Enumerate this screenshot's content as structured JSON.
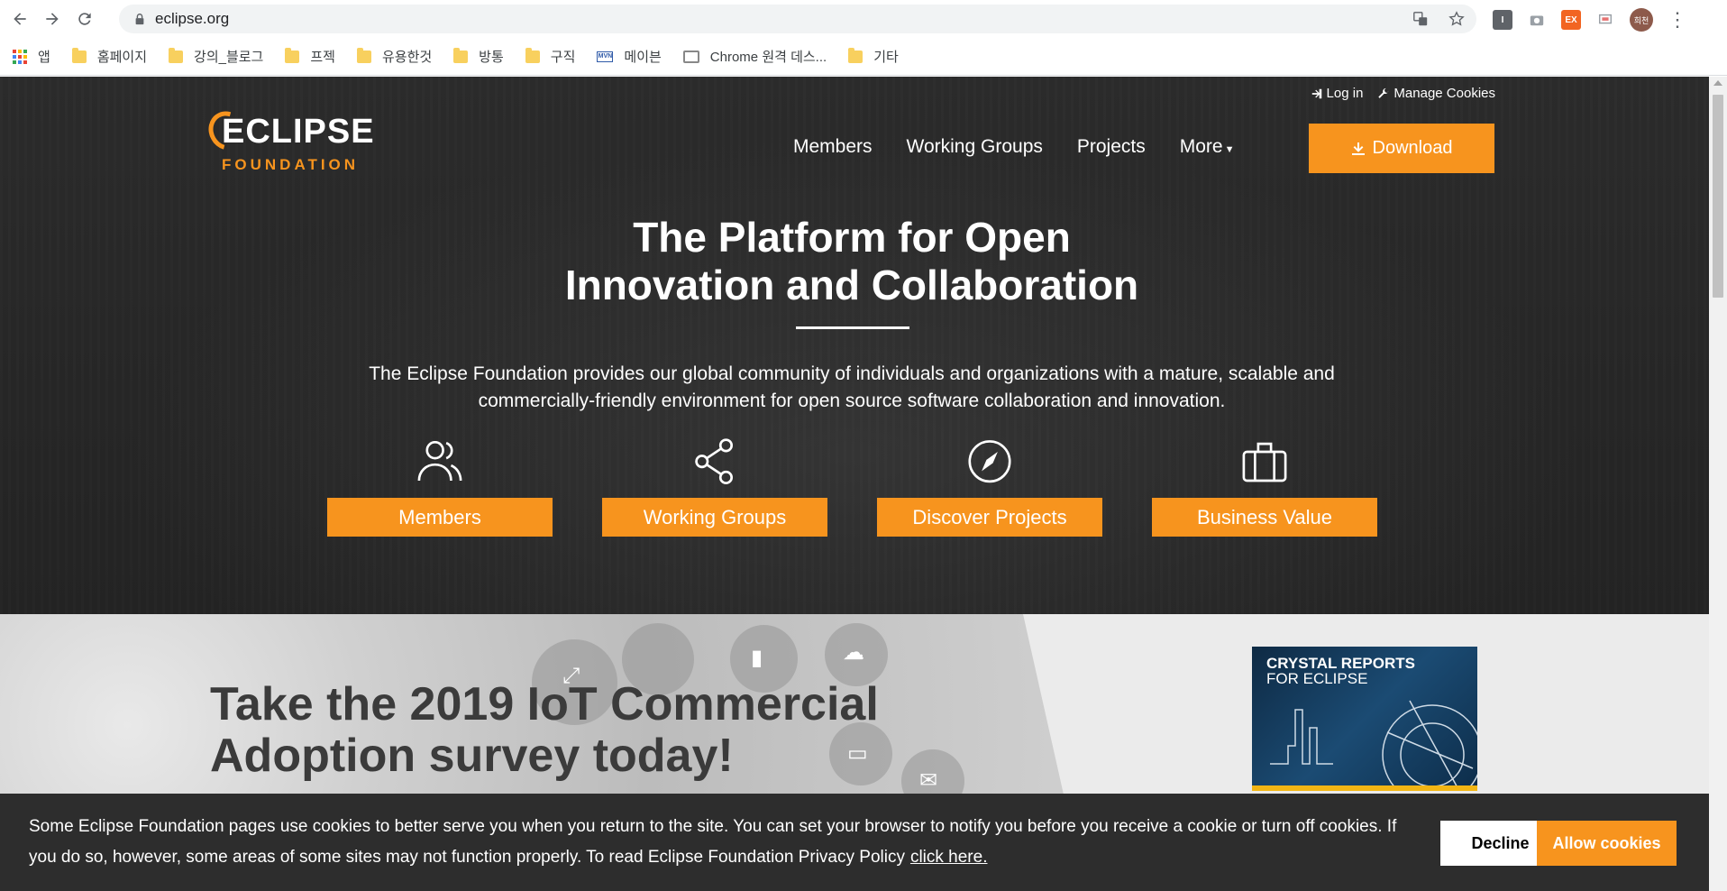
{
  "browser": {
    "url": "eclipse.org",
    "avatar_text": "희천",
    "extensions": [
      "I",
      "camera-icon",
      "EX",
      "cast-icon"
    ]
  },
  "bookmarks": [
    {
      "label": "앱",
      "type": "apps"
    },
    {
      "label": "홈페이지",
      "type": "folder"
    },
    {
      "label": "강의_블로그",
      "type": "folder"
    },
    {
      "label": "프젝",
      "type": "folder"
    },
    {
      "label": "유용한것",
      "type": "folder"
    },
    {
      "label": "방통",
      "type": "folder"
    },
    {
      "label": "구직",
      "type": "folder"
    },
    {
      "label": "메이븐",
      "type": "mvn"
    },
    {
      "label": "Chrome 원격 데스...",
      "type": "remote"
    },
    {
      "label": "기타",
      "type": "folder"
    }
  ],
  "header": {
    "login": "Log in",
    "manage_cookies": "Manage Cookies",
    "logo_top": "ECLIPSE",
    "logo_bottom": "FOUNDATION",
    "nav": [
      "Members",
      "Working Groups",
      "Projects",
      "More"
    ],
    "download": "Download"
  },
  "hero": {
    "title_line1": "The Platform for Open",
    "title_line2": "Innovation and Collaboration",
    "lead_line1": "The Eclipse Foundation provides our global community of individuals and organizations with a mature, scalable and",
    "lead_line2": "commercially-friendly environment for open source software collaboration and innovation.",
    "features": [
      {
        "label": "Members",
        "icon": "users-icon"
      },
      {
        "label": "Working Groups",
        "icon": "share-icon"
      },
      {
        "label": "Discover Projects",
        "icon": "compass-icon"
      },
      {
        "label": "Business Value",
        "icon": "briefcase-icon"
      }
    ]
  },
  "banner": {
    "title_line1": "Take the 2019 IoT Commercial",
    "title_line2": "Adoption survey today!",
    "ad_title": "CRYSTAL REPORTS",
    "ad_sub": "FOR ECLIPSE"
  },
  "cookie": {
    "text": "Some Eclipse Foundation pages use cookies to better serve you when you return to the site. You can set your browser to notify you before you receive a cookie or turn off cookies. If you do so, however, some areas of some sites may not function properly. To read Eclipse Foundation Privacy Policy",
    "link": "click here.",
    "decline": "Decline",
    "allow": "Allow cookies"
  },
  "colors": {
    "accent": "#f7941e",
    "hero_bg": "#262626",
    "cookie_bg": "#2d2d2d"
  }
}
